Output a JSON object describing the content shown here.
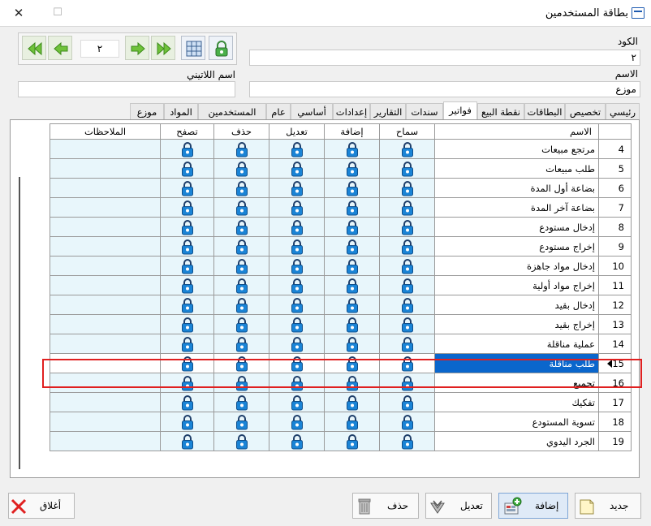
{
  "window": {
    "title": "بطاقة المستخدمين",
    "close_glyph": "✕",
    "maximize_glyph": "☐",
    "minimize_glyph": "—"
  },
  "nav": {
    "page_value": "٢"
  },
  "form": {
    "code_label": "الكود",
    "code_value": "٢",
    "name_label": "الاسم",
    "name_value": "موزع",
    "latin_name_label": "اسم اللاتيني",
    "latin_name_value": ""
  },
  "tabs": [
    "رئيسي",
    "تخصيص",
    "البطاقات",
    "نقطة البيع",
    "فواتير",
    "سندات",
    "التقارير",
    "إعدادات",
    "أساسي",
    "عام",
    "المستخدمين",
    "المواد",
    "موزع"
  ],
  "active_tab": "فواتير",
  "grid": {
    "headers": {
      "name": "الاسم",
      "allow": "سماح",
      "add": "إضافة",
      "edit": "تعديل",
      "delete": "حذف",
      "browse": "تصفح",
      "notes": "الملاحظات"
    },
    "rows": [
      {
        "num": "4",
        "name": "مرتجع مبيعات"
      },
      {
        "num": "5",
        "name": "طلب مبيعات"
      },
      {
        "num": "6",
        "name": "بضاعة أول المدة"
      },
      {
        "num": "7",
        "name": "بضاعة آخر المدة"
      },
      {
        "num": "8",
        "name": "إدخال مستودع"
      },
      {
        "num": "9",
        "name": "إخراج مستودع"
      },
      {
        "num": "10",
        "name": "إدخال مواد جاهزة"
      },
      {
        "num": "11",
        "name": "إخراج مواد أولية"
      },
      {
        "num": "12",
        "name": "إدخال بقيد"
      },
      {
        "num": "13",
        "name": "إخراج بقيد"
      },
      {
        "num": "14",
        "name": "عملية مناقلة"
      },
      {
        "num": "15",
        "name": "طلب مناقلة"
      },
      {
        "num": "16",
        "name": "تجميع"
      },
      {
        "num": "17",
        "name": "تفكيك"
      },
      {
        "num": "18",
        "name": "تسوية المستودع"
      },
      {
        "num": "19",
        "name": "الجرد اليدوي"
      }
    ],
    "selected_row": "15"
  },
  "buttons": {
    "new": "جديد",
    "add": "إضافة",
    "edit": "تعديل",
    "delete": "حذف",
    "close": "أغلاق"
  },
  "colors": {
    "selection": "#0a66cc",
    "perm_cell": "#e8f6fb",
    "lock": "#1a84d6",
    "highlight": "#e02020"
  },
  "icons": {
    "lock": "lock-icon",
    "first": "double-arrow-first-icon",
    "prev": "arrow-prev-icon",
    "next": "arrow-next-icon",
    "last": "double-arrow-last-icon",
    "grid": "grid-icon",
    "unlock": "unlock-icon"
  }
}
